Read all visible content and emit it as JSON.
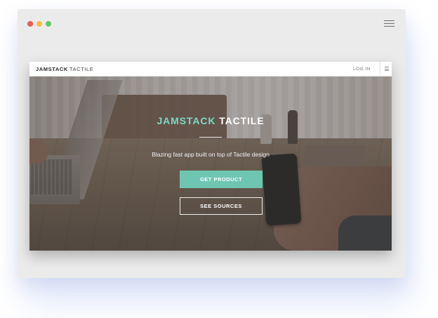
{
  "window": {
    "traffic_lights": [
      {
        "name": "close",
        "color": "#ee5a56"
      },
      {
        "name": "minimize",
        "color": "#f0bf3d"
      },
      {
        "name": "maximize",
        "color": "#5fc86a"
      }
    ],
    "menu_icon": "hamburger-menu-icon"
  },
  "navbar": {
    "brand_bold": "JAMSTACK",
    "brand_light": "TACTILE",
    "login_label": "LOG IN",
    "menu_icon": "hamburger-menu-icon"
  },
  "hero": {
    "title_accent": "JAMSTACK",
    "title_main": "TACTILE",
    "tagline": "Blazing fast app built on top of Tactile design",
    "primary_button": "GET PRODUCT",
    "secondary_button": "SEE SOURCES"
  },
  "colors": {
    "accent": "#6fc6b0",
    "title_accent": "#7fd8c4",
    "window_bg": "#ebebeb"
  }
}
